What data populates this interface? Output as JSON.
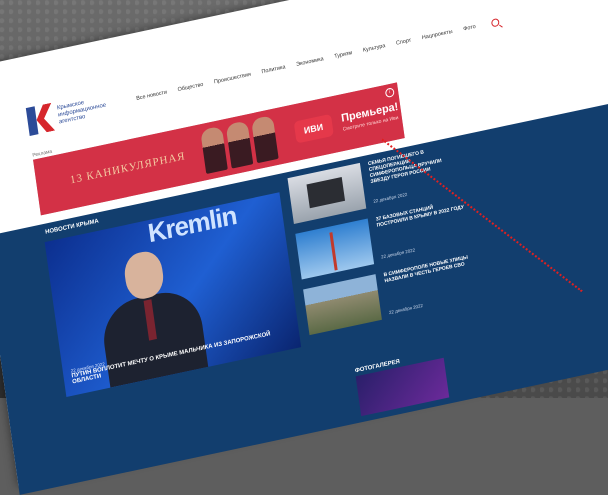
{
  "site": {
    "logo_text": "Крымское информационное агентство",
    "nav": [
      "Все новости",
      "Общество",
      "Происшествия",
      "Политика",
      "Экономика",
      "Туризм",
      "Культура",
      "Спорт",
      "Нацпроекты",
      "Фото"
    ]
  },
  "ad": {
    "label": "Реклама",
    "brand": "13 КАНИКУЛЯРНАЯ",
    "logo": "ИВИ",
    "headline": "Премьера!",
    "sub": "Смотрите только на Иви",
    "info": "i"
  },
  "main": {
    "section_title": "НОВОСТИ КРЫМА",
    "hero": {
      "brand": "Kremlin",
      "date": "22 декабря 2022",
      "caption": "ПУТИН ВОПЛОТИТ МЕЧТУ О КРЫМЕ МАЛЬЧИКА ИЗ ЗАПОРОЖСКОЙ ОБЛАСТИ"
    },
    "news": [
      {
        "title": "СЕМЬЯ ПОГИБШЕГО В СПЕЦОПЕРАЦИИ СИМФЕРОПОЛЬЦА ВРУЧИЛИ ЗВЕЗДУ ГЕРОЯ РОССИИ",
        "date": "22 декабря 2022"
      },
      {
        "title": "37 БАЗОВЫХ СТАНЦИЙ ПОСТРОИЛИ В КРЫМУ В 2022 ГОДУ",
        "date": "22 декабря 2022"
      },
      {
        "title": "В СИМФЕРОПОЛЕ НОВЫЕ УЛИЦЫ НАЗВАЛИ В ЧЕСТЬ ГЕРОЕВ СВО",
        "date": "22 декабря 2022"
      }
    ],
    "gallery_title": "ФОТОГАЛЕРЕЯ"
  },
  "colors": {
    "accent": "#d6262c",
    "brand_blue": "#2c4b98",
    "section_bg": "#123e6e",
    "annotation": "#e02020"
  }
}
